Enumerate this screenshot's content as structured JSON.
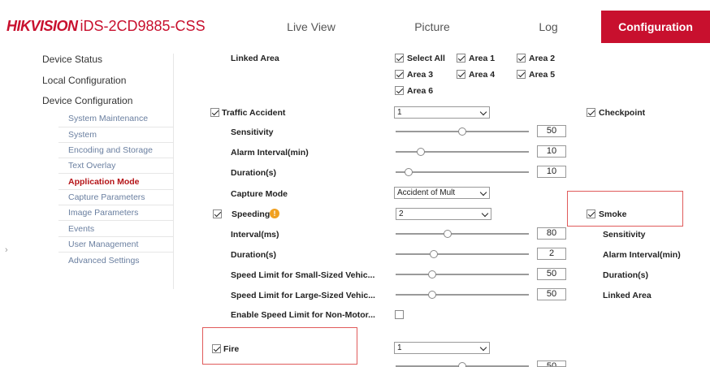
{
  "header": {
    "brand_hik": "HIK",
    "brand_vision": "VISION",
    "model": "iDS-2CD9885-CSS",
    "tabs": [
      {
        "label": "Live View"
      },
      {
        "label": "Picture"
      },
      {
        "label": "Log"
      },
      {
        "label": "Configuration",
        "active": true
      }
    ]
  },
  "sidebar": {
    "device_status": "Device Status",
    "local_configuration": "Local Configuration",
    "device_configuration": "Device Configuration",
    "sub_items": [
      {
        "label": "System Maintenance"
      },
      {
        "label": "System"
      },
      {
        "label": "Encoding and Storage"
      },
      {
        "label": "Text Overlay"
      },
      {
        "label": "Application Mode",
        "active": true
      },
      {
        "label": "Capture Parameters"
      },
      {
        "label": "Image Parameters"
      },
      {
        "label": "Events"
      },
      {
        "label": "User Management"
      },
      {
        "label": "Advanced Settings"
      }
    ]
  },
  "linked_area": {
    "label": "Linked Area",
    "options": [
      {
        "label": "Select All",
        "checked": true
      },
      {
        "label": "Area 1",
        "checked": true
      },
      {
        "label": "Area 2",
        "checked": true
      },
      {
        "label": "Area 3",
        "checked": true
      },
      {
        "label": "Area 4",
        "checked": true
      },
      {
        "label": "Area 5",
        "checked": true
      },
      {
        "label": "Area 6",
        "checked": true
      }
    ]
  },
  "traffic_accident": {
    "label": "Traffic Accident",
    "checked": true,
    "select_value": "1",
    "sensitivity_label": "Sensitivity",
    "sensitivity_value": "50",
    "sensitivity_fraction": 0.5,
    "alarm_interval_label": "Alarm Interval(min)",
    "alarm_interval_value": "10",
    "alarm_interval_fraction": 0.17,
    "duration_label": "Duration(s)",
    "duration_value": "10",
    "duration_fraction": 0.07,
    "capture_mode_label": "Capture Mode",
    "capture_mode_value": "Accident of Mult"
  },
  "checkpoint": {
    "label": "Checkpoint",
    "checked": true
  },
  "speeding": {
    "label": "Speeding",
    "checked": true,
    "select_value": "2",
    "interval_label": "Interval(ms)",
    "interval_value": "80",
    "interval_fraction": 0.38,
    "duration_label": "Duration(s)",
    "duration_value": "2",
    "duration_fraction": 0.27,
    "small_limit_label": "Speed Limit for Small-Sized Vehic...",
    "small_limit_value": "50",
    "small_limit_fraction": 0.26,
    "large_limit_label": "Speed Limit for Large-Sized Vehic...",
    "large_limit_value": "50",
    "large_limit_fraction": 0.26,
    "non_motor_label": "Enable Speed Limit for Non-Motor...",
    "non_motor_checked": false
  },
  "smoke": {
    "label": "Smoke",
    "checked": true,
    "sensitivity_label": "Sensitivity",
    "alarm_interval_label": "Alarm Interval(min)",
    "duration_label": "Duration(s)",
    "linked_area_label": "Linked Area"
  },
  "fire": {
    "label": "Fire",
    "checked": true,
    "select_value": "1",
    "sensitivity_value": "50",
    "sensitivity_fraction": 0.5
  },
  "colors": {
    "brand_red": "#c8102e",
    "active_sub": "#b51418",
    "sub_item": "#6a7fa0",
    "highlight_box": "#e05b5b"
  }
}
